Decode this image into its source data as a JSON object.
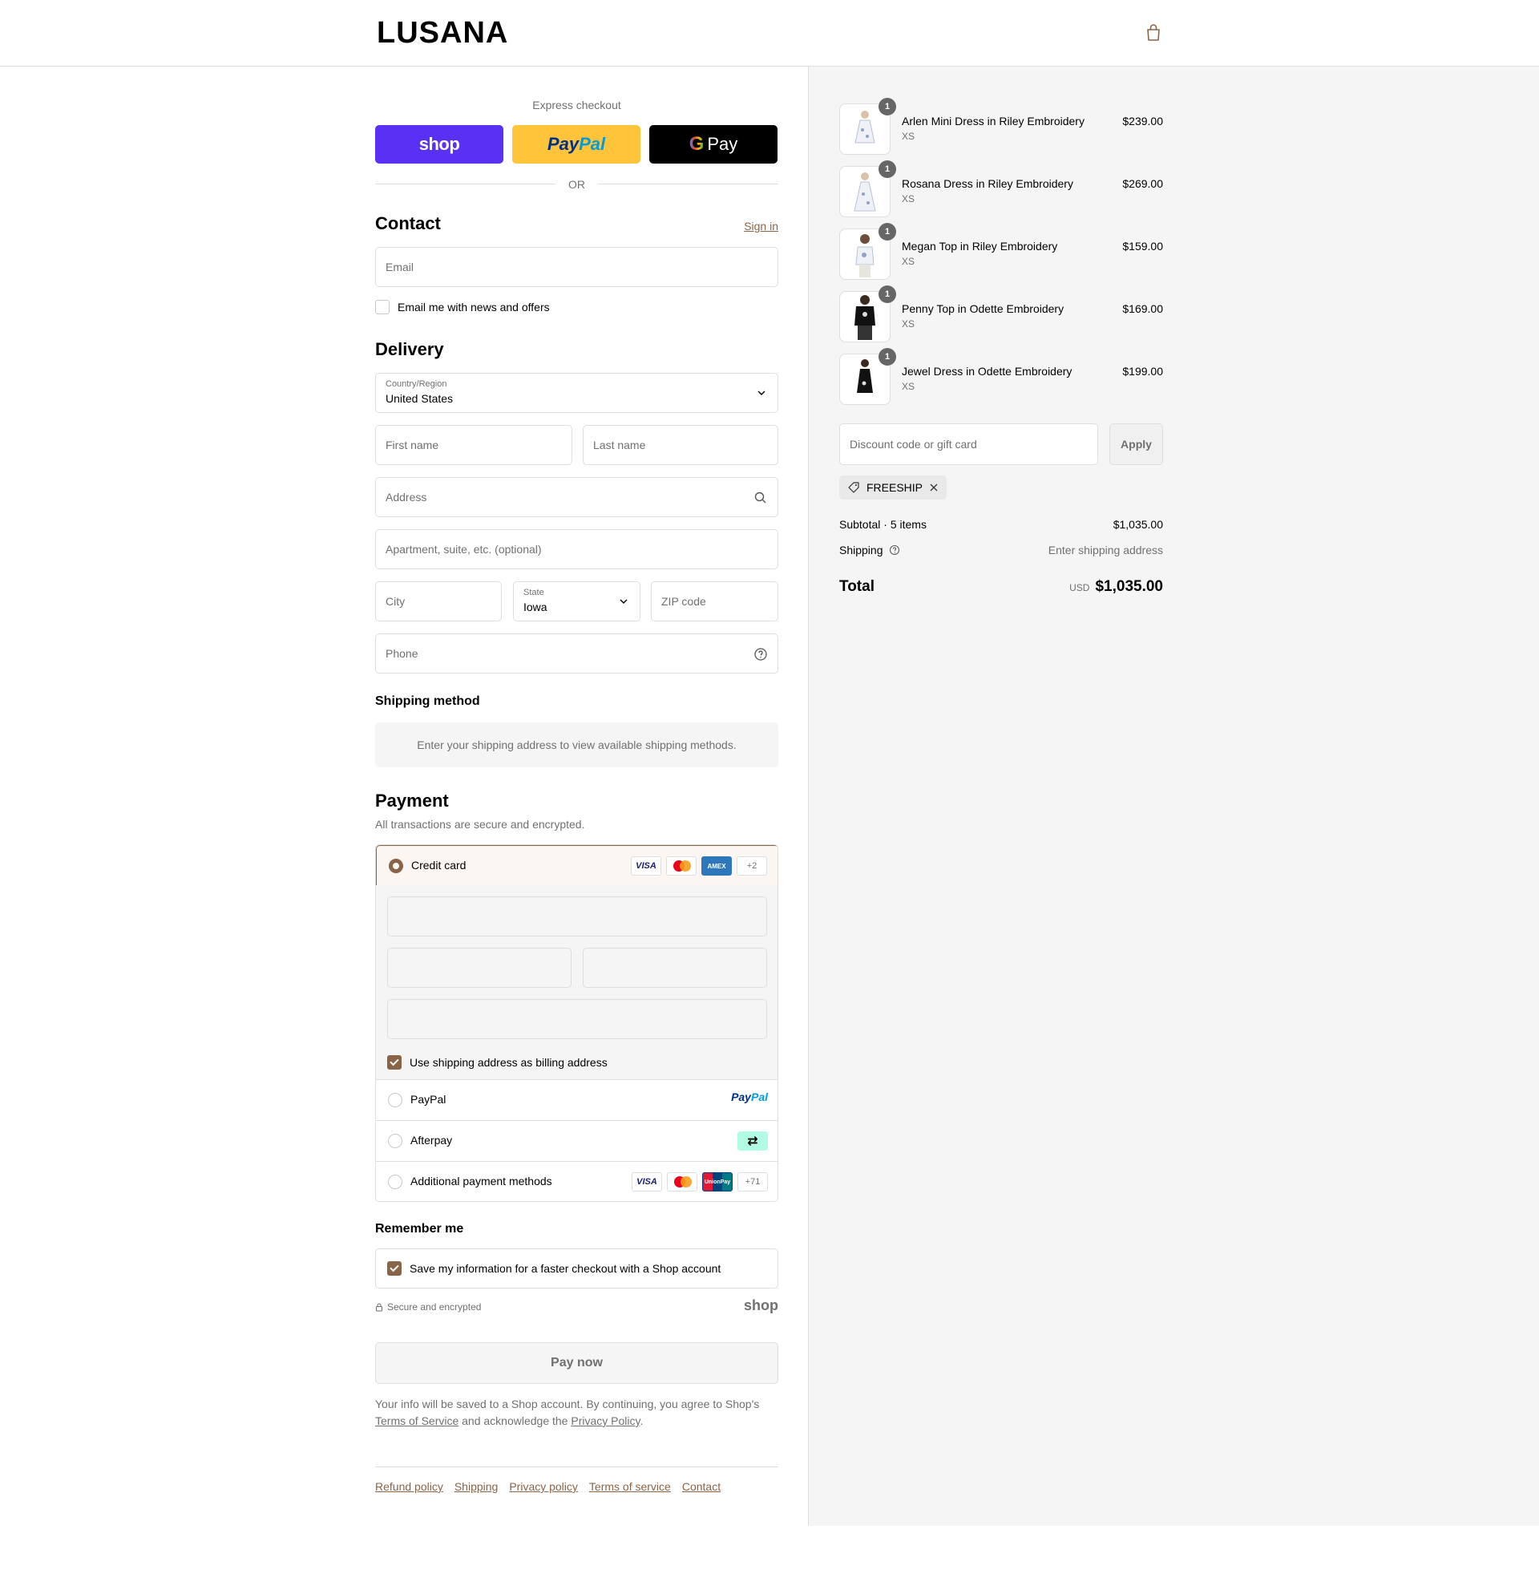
{
  "brand": {
    "logo": "LUSANA"
  },
  "express": {
    "title": "Express checkout",
    "shop_label": "shop",
    "paypal_label_1": "Pay",
    "paypal_label_2": "Pal",
    "gpay_g": "G",
    "gpay_label": "Pay",
    "or": "OR"
  },
  "contact": {
    "title": "Contact",
    "signin": "Sign in",
    "email_placeholder": "Email",
    "news_label": "Email me with news and offers",
    "news_checked": false
  },
  "delivery": {
    "title": "Delivery",
    "country_label": "Country/Region",
    "country_value": "United States",
    "first_name": "First name",
    "last_name": "Last name",
    "address": "Address",
    "apartment": "Apartment, suite, etc. (optional)",
    "city": "City",
    "state_label": "State",
    "state_value": "Iowa",
    "zip": "ZIP code",
    "phone": "Phone"
  },
  "shipping_method": {
    "title": "Shipping method",
    "note": "Enter your shipping address to view available shipping methods."
  },
  "payment": {
    "title": "Payment",
    "subtitle": "All transactions are secure and encrypted.",
    "credit_card": "Credit card",
    "visa": "VISA",
    "amex": "AMEX",
    "unionpay": "UnionPay",
    "credit_more": "+2",
    "billing_label": "Use shipping address as billing address",
    "billing_checked": true,
    "paypal": "PayPal",
    "paypal_logo_1": "Pay",
    "paypal_logo_2": "Pal",
    "afterpay": "Afterpay",
    "afterpay_glyph": "⇄",
    "additional": "Additional payment methods",
    "additional_more": "+71"
  },
  "remember": {
    "title": "Remember me",
    "save_label": "Save my information for a faster checkout with a Shop account",
    "save_checked": true,
    "secure": "Secure and encrypted",
    "shop_logo": "shop"
  },
  "pay_now": "Pay now",
  "legal": {
    "line1": "Your info will be saved to a Shop account. By continuing, you agree to Shop's",
    "terms": "Terms of Service",
    "mid": "and acknowledge the",
    "privacy": "Privacy Policy",
    "end": "."
  },
  "footer": [
    "Refund policy",
    "Shipping",
    "Privacy policy",
    "Terms of service",
    "Contact"
  ],
  "summary": {
    "items": [
      {
        "name": "Arlen Mini Dress in Riley Embroidery",
        "variant": "XS",
        "price": "$239.00",
        "qty": "1",
        "dark": false
      },
      {
        "name": "Rosana Dress in Riley Embroidery",
        "variant": "XS",
        "price": "$269.00",
        "qty": "1",
        "dark": false
      },
      {
        "name": "Megan Top in Riley Embroidery",
        "variant": "XS",
        "price": "$159.00",
        "qty": "1",
        "dark": false
      },
      {
        "name": "Penny Top in Odette Embroidery",
        "variant": "XS",
        "price": "$169.00",
        "qty": "1",
        "dark": true
      },
      {
        "name": "Jewel Dress in Odette Embroidery",
        "variant": "XS",
        "price": "$199.00",
        "qty": "1",
        "dark": true
      }
    ],
    "discount_placeholder": "Discount code or gift card",
    "apply": "Apply",
    "code": "FREESHIP",
    "subtotal_label": "Subtotal · 5 items",
    "subtotal_value": "$1,035.00",
    "shipping_label": "Shipping",
    "shipping_value": "Enter shipping address",
    "total_label": "Total",
    "currency": "USD",
    "total_value": "$1,035.00"
  },
  "colors": {
    "accent": "#8a6447",
    "shop_purple": "#5a31f4",
    "paypal_yellow": "#ffc439",
    "panel_bg": "#f5f5f5",
    "border": "#dedede"
  }
}
